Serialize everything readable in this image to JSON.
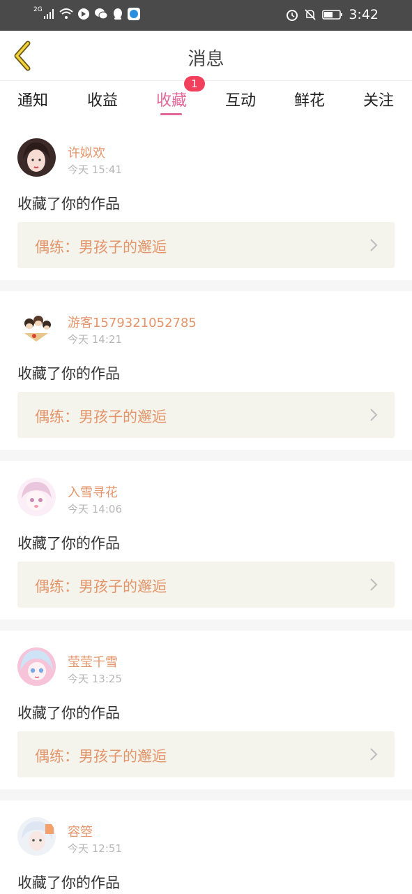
{
  "status_bar": {
    "network": "2G",
    "time": "3:42"
  },
  "header": {
    "title": "消息",
    "back_label": "back"
  },
  "tabs": [
    {
      "label": "通知"
    },
    {
      "label": "收益"
    },
    {
      "label": "收藏",
      "active": true,
      "badge": "1"
    },
    {
      "label": "互动"
    },
    {
      "label": "鲜花"
    },
    {
      "label": "关注"
    }
  ],
  "colors": {
    "accent": "#e4679a",
    "name": "#e3956b",
    "badge": "#f23f5c"
  },
  "messages": [
    {
      "username": "许姒欢",
      "time": "今天 15:41",
      "action": "收藏了你的作品",
      "work_title": "偶练：男孩子的邂逅"
    },
    {
      "username": "游客1579321052785",
      "time": "今天 14:21",
      "action": "收藏了你的作品",
      "work_title": "偶练：男孩子的邂逅"
    },
    {
      "username": "入雪寻花",
      "time": "今天 14:06",
      "action": "收藏了你的作品",
      "work_title": "偶练：男孩子的邂逅"
    },
    {
      "username": "莹莹千雪",
      "time": "今天 13:25",
      "action": "收藏了你的作品",
      "work_title": "偶练：男孩子的邂逅"
    },
    {
      "username": "容箜",
      "time": "今天 12:51",
      "action": "收藏了你的作品"
    }
  ]
}
